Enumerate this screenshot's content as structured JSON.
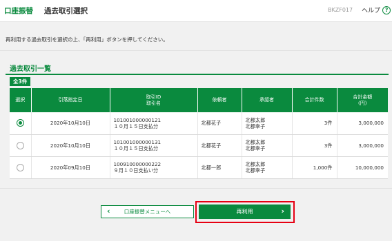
{
  "header": {
    "brand": "口座振替",
    "page_name": "過去取引選択",
    "screen_id": "BKZF017",
    "help_label": "ヘルプ",
    "help_icon": "?"
  },
  "instruction": "再利用する過去取引を選択の上、「再利用」ボタンを押してください。",
  "section": {
    "title": "過去取引一覧",
    "count_badge": "全3件"
  },
  "table": {
    "columns": [
      {
        "line1": "選択",
        "line2": ""
      },
      {
        "line1": "引落指定日",
        "line2": ""
      },
      {
        "line1": "取引ID",
        "line2": "取引名"
      },
      {
        "line1": "依頼者",
        "line2": ""
      },
      {
        "line1": "承認者",
        "line2": ""
      },
      {
        "line1": "合計件数",
        "line2": ""
      },
      {
        "line1": "合計金額",
        "line2": "(円)"
      }
    ],
    "rows": [
      {
        "selected": true,
        "date": "2020年10月10日",
        "id": "101001000000121",
        "name": "１０月１５日支払分",
        "requester": "北都花子",
        "approver1": "北都太郎",
        "approver2": "北都幸子",
        "count": "3件",
        "amount": "3,000,000"
      },
      {
        "selected": false,
        "date": "2020年10月10日",
        "id": "101001000000131",
        "name": "１０月１５日支払分",
        "requester": "北都花子",
        "approver1": "北都太郎",
        "approver2": "北都幸子",
        "count": "3件",
        "amount": "3,000,000"
      },
      {
        "selected": false,
        "date": "2020年09月10日",
        "id": "100910000000222",
        "name": "９月１０日支払い分",
        "requester": "北都一郎",
        "approver1": "北都太郎",
        "approver2": "北都幸子",
        "count": "1,000件",
        "amount": "10,000,000"
      }
    ]
  },
  "buttons": {
    "back_label": "口座振替メニューへ",
    "back_icon": "chevron-left-icon",
    "reuse_label": "再利用",
    "reuse_icon": "chevron-right-icon"
  },
  "colors": {
    "accent": "#0a8a3e",
    "highlight": "#e60012"
  }
}
